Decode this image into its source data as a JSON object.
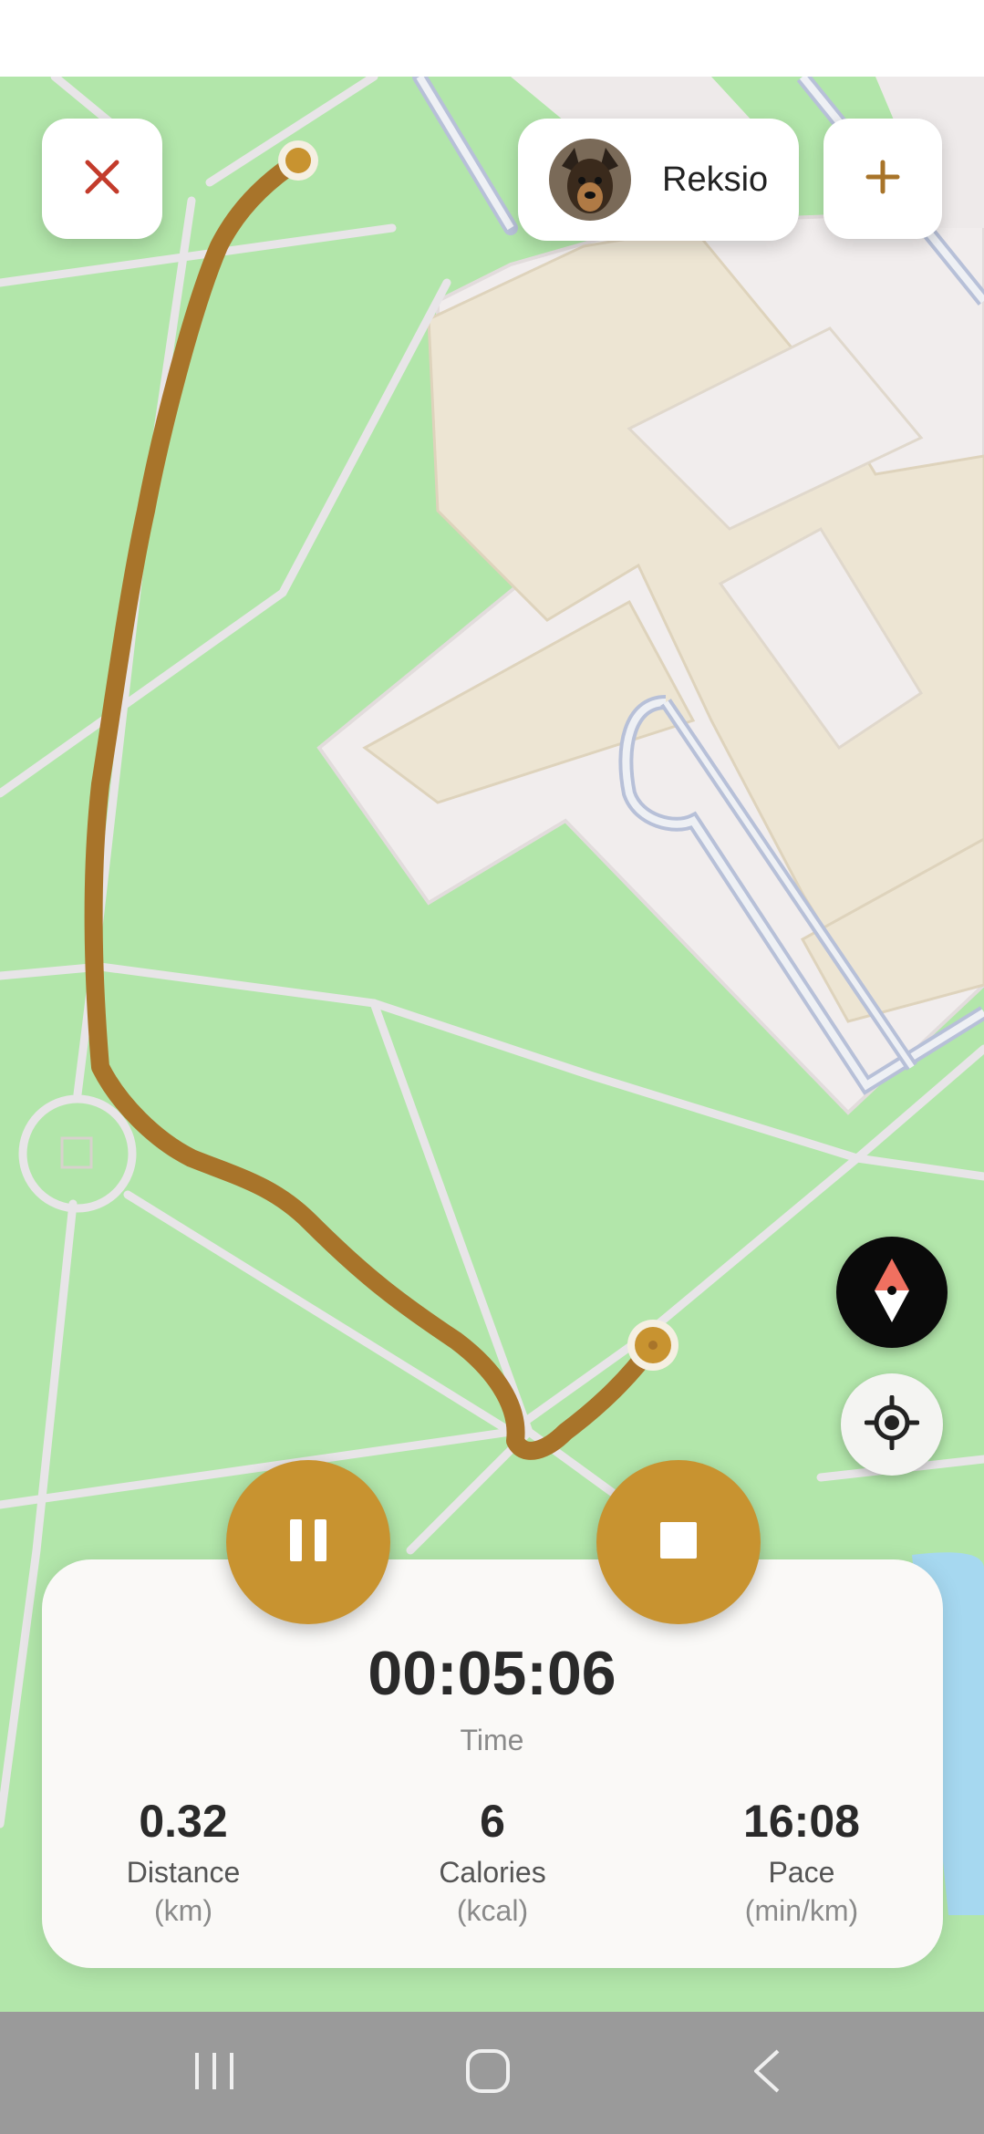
{
  "header": {
    "pet_name": "Reksio",
    "close_icon": "close-icon",
    "add_icon": "plus-icon"
  },
  "map": {
    "compass_icon": "compass-icon",
    "locate_icon": "locate-crosshair-icon",
    "route_color": "#a8742a",
    "marker_color": "#c89330"
  },
  "controls": {
    "pause_icon": "pause-icon",
    "stop_icon": "stop-icon",
    "accent": "#c89330"
  },
  "stats": {
    "time": {
      "value": "00:05:06",
      "label": "Time"
    },
    "distance": {
      "value": "0.32",
      "label": "Distance",
      "unit": "(km)"
    },
    "calories": {
      "value": "6",
      "label": "Calories",
      "unit": "(kcal)"
    },
    "pace": {
      "value": "16:08",
      "label": "Pace",
      "unit": "(min/km)"
    }
  },
  "nav": {
    "recents_icon": "recent-apps-icon",
    "home_icon": "home-icon",
    "back_icon": "back-icon"
  }
}
